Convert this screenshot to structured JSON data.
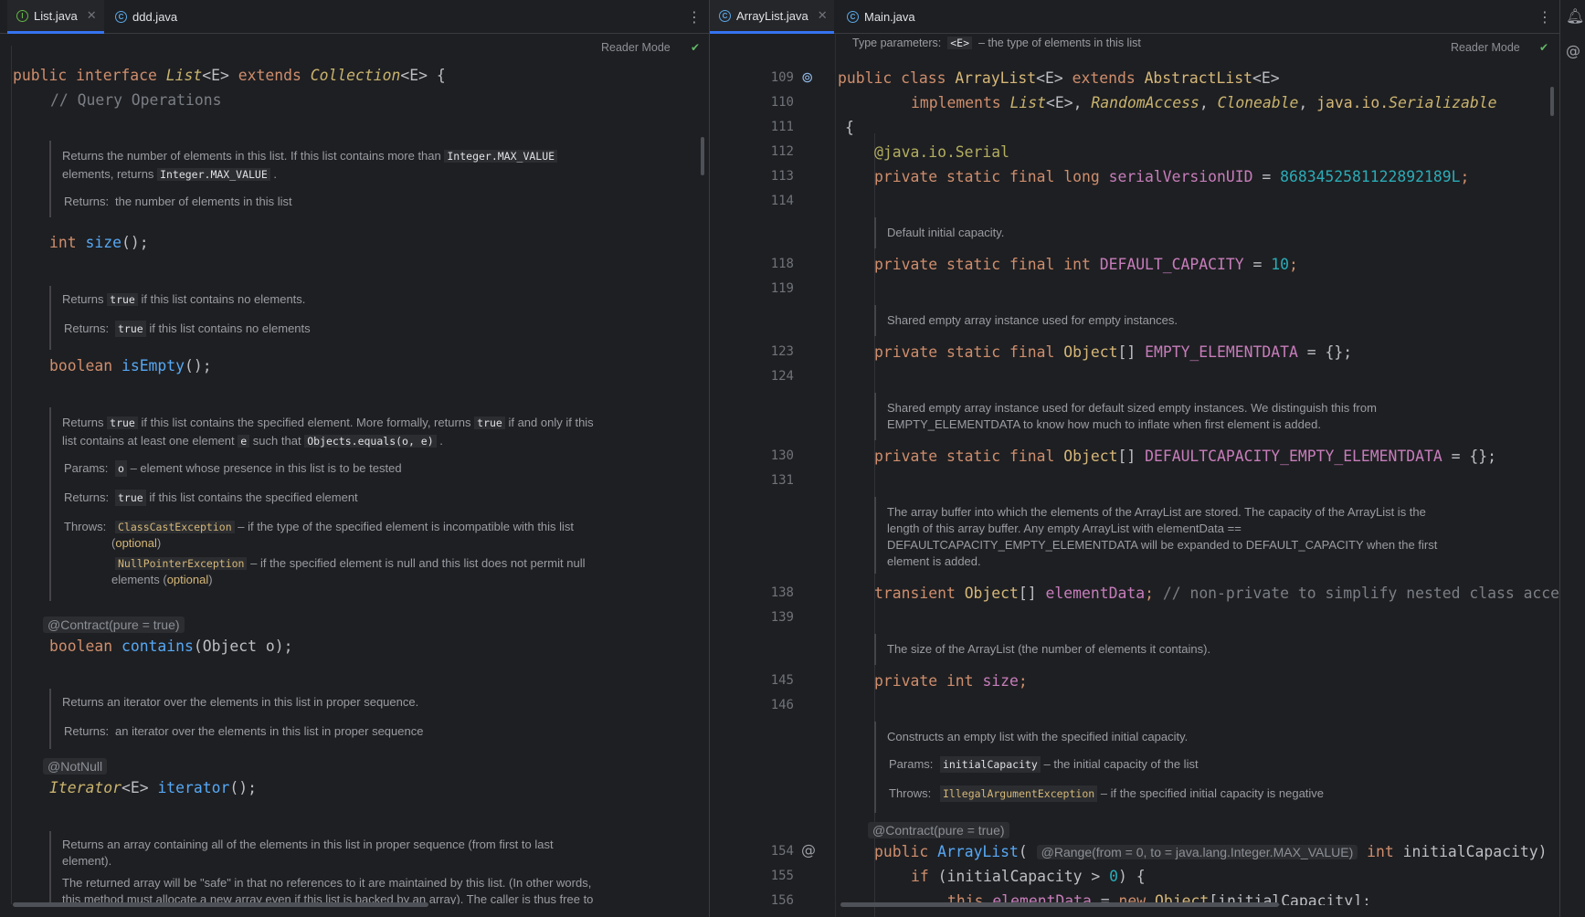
{
  "left": {
    "tabs": [
      {
        "label": "List.java",
        "icon": "interface-icon",
        "active": true
      },
      {
        "label": "ddd.java",
        "icon": "class-icon",
        "active": false
      }
    ],
    "reader_mode": "Reader Mode",
    "code": {
      "decl": [
        "public",
        "interface",
        "List",
        "<E>",
        "extends",
        "Collection",
        "<E>",
        "{"
      ],
      "comment_query": "// Query Operations",
      "size_sig": [
        "int",
        "size",
        "();"
      ],
      "isempty_sig": [
        "boolean",
        "isEmpty",
        "();"
      ],
      "contains_sig": [
        "boolean",
        "contains",
        "(Object o);"
      ],
      "iterator_sig": [
        "Iterator",
        "<E>",
        "iterator",
        "();"
      ]
    },
    "docs": {
      "size_text_1": "Returns the number of elements in this list. If this list contains more than",
      "size_code_1": "Integer.MAX_VALUE",
      "size_text_2": "elements, returns",
      "size_code_2": "Integer.MAX_VALUE",
      "size_text_3": ".",
      "size_returns_label": "Returns:",
      "size_returns": "the number of elements in this list",
      "isempty_text_1": "Returns",
      "isempty_code": "true",
      "isempty_text_2": "if this list contains no elements.",
      "isempty_returns_label": "Returns:",
      "isempty_returns_code": "true",
      "isempty_returns": "if this list contains no elements",
      "contains_t1": "Returns",
      "contains_c1": "true",
      "contains_t2": "if this list contains the specified element. More formally, returns",
      "contains_c2": "true",
      "contains_t3": "if and only if this",
      "contains_t4": "list contains at least one element",
      "contains_c3": "e",
      "contains_t5": "such that",
      "contains_c4": "Objects.equals(o, e)",
      "contains_t6": ".",
      "params_label": "Params:",
      "params_code": "o",
      "params_text": "– element whose presence in this list is to be tested",
      "returns_label": "Returns:",
      "returns_code": "true",
      "returns_text": "if this list contains the specified element",
      "throws_label": "Throws:",
      "throws_1_code": "ClassCastException",
      "throws_1_text": "– if the type of the specified element is incompatible with this list",
      "throws_1_open": "(",
      "throws_1_opt": "optional",
      "throws_1_close": ")",
      "throws_2_code": "NullPointerException",
      "throws_2_text": "– if the specified element is null and this list does not permit null",
      "throws_2_pre": "elements (",
      "throws_2_opt": "optional",
      "throws_2_close": ")",
      "iterator_text": "Returns an iterator over the elements in this list in proper sequence.",
      "iterator_returns_label": "Returns:",
      "iterator_returns": "an iterator over the elements in this list in proper sequence",
      "toarray_text_1": "Returns an array containing all of the elements in this list in proper sequence (from first to last",
      "toarray_text_2": "element).",
      "toarray_text_3": "The returned array will be \"safe\" in that no references to it are maintained by this list. (In other words,",
      "toarray_text_4": "this method must allocate a new array even if this list is backed by an array). The caller is thus free to"
    },
    "annotations": {
      "contract": "@Contract(pure = true)",
      "notnull": "@NotNull"
    }
  },
  "right": {
    "tabs": [
      {
        "label": "ArrayList.java",
        "icon": "class-icon",
        "active": true
      },
      {
        "label": "Main.java",
        "icon": "class-icon",
        "active": false
      }
    ],
    "reader_mode": "Reader Mode",
    "type_params_label": "Type parameters:",
    "type_params_code": "<E>",
    "type_params_text": "– the type of elements in this list",
    "line_numbers": [
      "109",
      "110",
      "111",
      "112",
      "113",
      "114",
      "118",
      "119",
      "123",
      "124",
      "130",
      "131",
      "138",
      "139",
      "145",
      "146",
      "154",
      "155",
      "156"
    ],
    "code": {
      "l109": [
        "public",
        "class",
        "ArrayList",
        "<E>",
        "extends",
        "AbstractList",
        "<E>"
      ],
      "l110": [
        "implements",
        "List",
        "<E>",
        ",",
        "RandomAccess",
        ",",
        "Cloneable",
        ",",
        "java.io.",
        "Serializable"
      ],
      "l111": "{",
      "l112_ann": "@java.io.Serial",
      "l113": [
        "private static final long",
        "serialVersionUID",
        "=",
        "8683452581122892189L",
        ";"
      ],
      "l118": [
        "private static final int",
        "DEFAULT_CAPACITY",
        "=",
        "10",
        ";"
      ],
      "l123": [
        "private static final",
        "Object",
        "[]",
        "EMPTY_ELEMENTDATA",
        "= {};"
      ],
      "l130": [
        "private static final",
        "Object",
        "[]",
        "DEFAULTCAPACITY_EMPTY_ELEMENTDATA",
        "= {};"
      ],
      "l138": [
        "transient",
        "Object",
        "[]",
        "elementData",
        ";",
        "// non-private to simplify nested class access"
      ],
      "l145": [
        "private int",
        "size",
        ";"
      ],
      "l154": [
        "public",
        "ArrayList",
        "(",
        "int",
        "initialCapacity",
        ")"
      ],
      "l155": [
        "if",
        "(initialCapacity >",
        "0",
        ") {"
      ],
      "l156": [
        "this",
        ".",
        "elementData",
        "=",
        "new",
        "Object",
        "[initialCapacity];"
      ]
    },
    "docs": {
      "default_capacity": "Default initial capacity.",
      "empty_elementdata": "Shared empty array instance used for empty instances.",
      "default_empty_1": "Shared empty array instance used for default sized empty instances. We distinguish this from",
      "default_empty_2": "EMPTY_ELEMENTDATA to know how much to inflate when first element is added.",
      "elementdata_1": "The array buffer into which the elements of the ArrayList are stored. The capacity of the ArrayList is the",
      "elementdata_2": "length of this array buffer. Any empty ArrayList with elementData ==",
      "elementdata_3": "DEFAULTCAPACITY_EMPTY_ELEMENTDATA will be expanded to DEFAULT_CAPACITY when the first",
      "elementdata_4": "element is added.",
      "size_doc": "The size of the ArrayList (the number of elements it contains).",
      "ctor_text": "Constructs an empty list with the specified initial capacity.",
      "ctor_params_label": "Params:",
      "ctor_params_code": "initialCapacity",
      "ctor_params_text": "– the initial capacity of the list",
      "ctor_throws_label": "Throws:",
      "ctor_throws_code": "IllegalArgumentException",
      "ctor_throws_text": "– if the specified initial capacity is negative"
    },
    "annotations": {
      "contract": "@Contract(pure = true)",
      "range_hint": "@Range(from = 0, to = java.lang.Integer.MAX_VALUE)"
    }
  }
}
